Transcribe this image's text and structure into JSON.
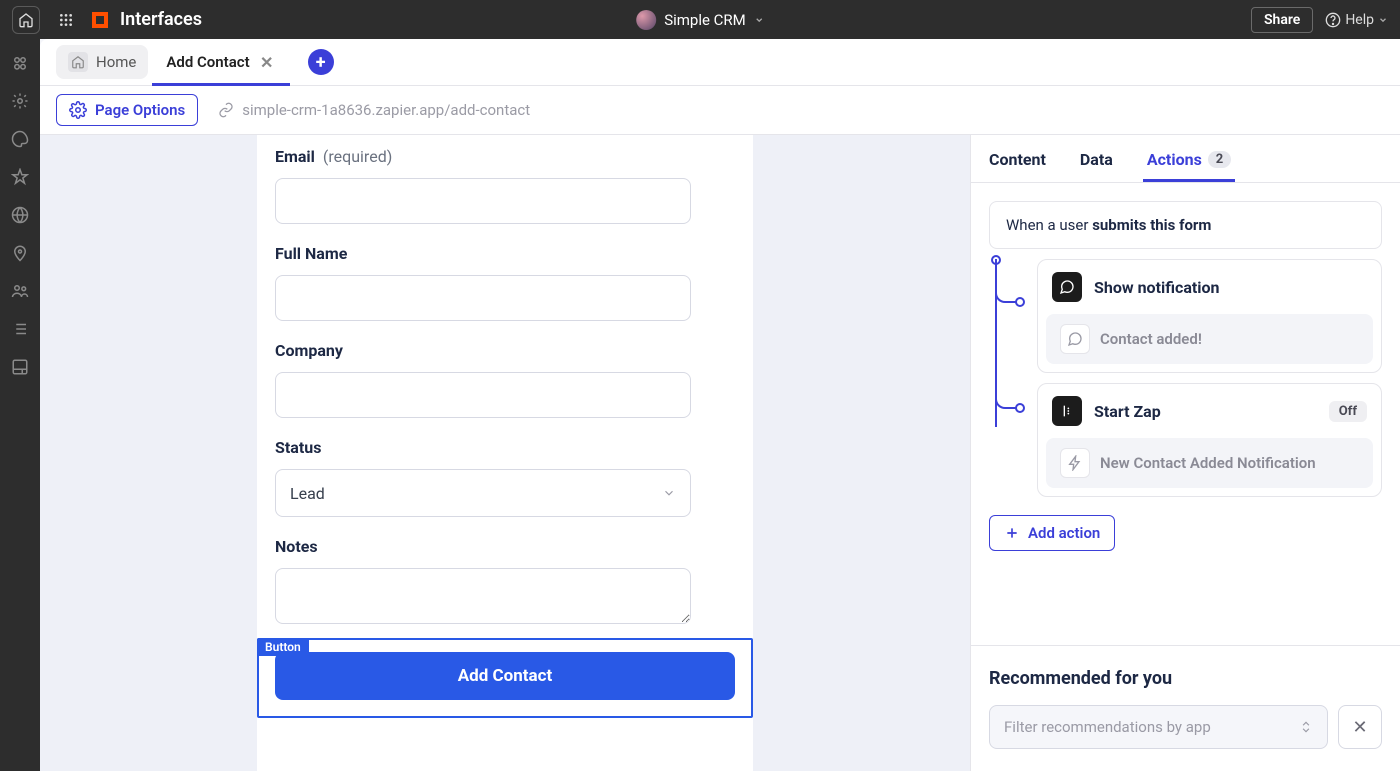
{
  "topbar": {
    "title": "Interfaces",
    "workspace": "Simple CRM",
    "share": "Share",
    "help": "Help"
  },
  "tabs": {
    "home": "Home",
    "active": "Add Contact"
  },
  "optbar": {
    "page_options": "Page Options",
    "url": "simple-crm-1a8636.zapier.app/add-contact"
  },
  "form": {
    "email_label": "Email",
    "required": "(required)",
    "fullname_label": "Full Name",
    "company_label": "Company",
    "status_label": "Status",
    "status_value": "Lead",
    "notes_label": "Notes",
    "button_tag": "Button",
    "submit_label": "Add Contact"
  },
  "rpanel": {
    "tab_content": "Content",
    "tab_data": "Data",
    "tab_actions": "Actions",
    "actions_count": "2",
    "trigger_prefix": "When a user ",
    "trigger_event": "submits this form",
    "actions": [
      {
        "title": "Show notification",
        "sub": "Contact added!"
      },
      {
        "title": "Start Zap",
        "off": "Off",
        "sub": "New Contact Added Notification"
      }
    ],
    "add_action": "Add action",
    "recs_title": "Recommended for you",
    "filter_placeholder": "Filter recommendations by app"
  }
}
